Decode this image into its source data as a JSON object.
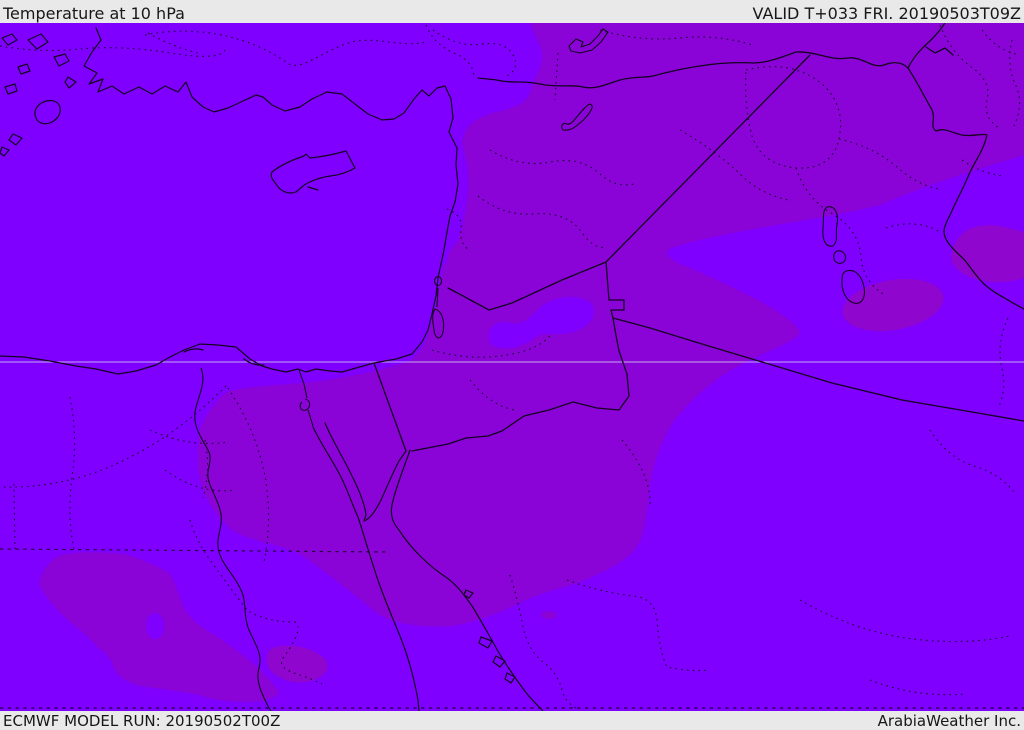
{
  "header": {
    "title": "Temperature at 10 hPa",
    "valid": "VALID T+033 FRI. 20190503T09Z"
  },
  "footer": {
    "model_run": "ECMWF MODEL RUN: 20190502T00Z",
    "brand": "ArabiaWeather Inc."
  },
  "map": {
    "parameter": "Temperature at 10 hPa",
    "model": "ECMWF",
    "region": "Eastern Mediterranean / Middle East",
    "colors": {
      "bar-bg": "#e9e9e9",
      "bar-text": "#171717",
      "temp-base": "#7f00ff",
      "temp-dark": "#8a04d8",
      "temp-patch": "#8f06cf",
      "line": "#150021",
      "dots": "#1d0630",
      "graticule": "#cbbcf0"
    }
  }
}
